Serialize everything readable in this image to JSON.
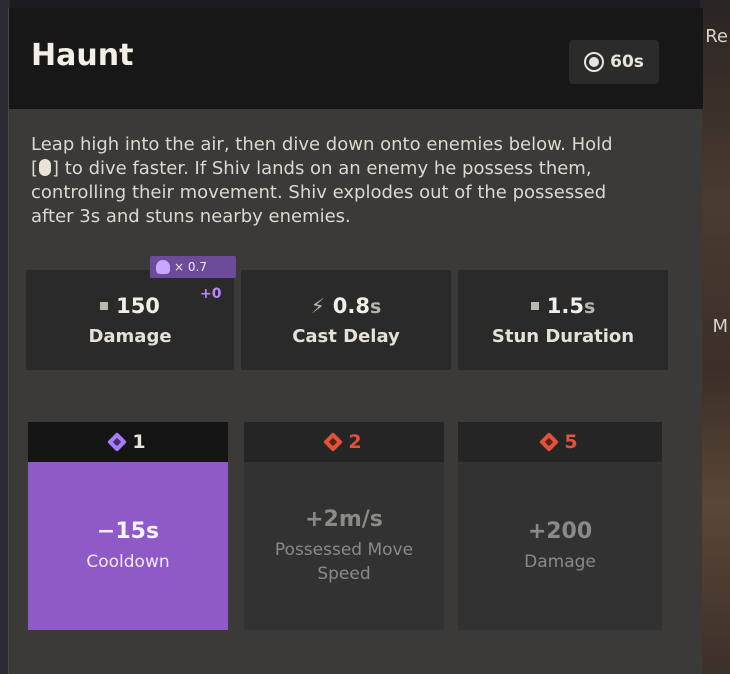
{
  "ability": {
    "name": "Haunt",
    "cooldown": "60s",
    "description_lines": [
      "Leap high into the air, then dive down onto enemies below. Hold",
      "] to dive faster. If Shiv lands on an enemy he possess them,",
      "controlling their movement. Shiv explodes out of the possessed",
      "after 3s and stuns nearby enemies."
    ],
    "description_line2_prefix": "["
  },
  "scaling": {
    "multiplier": "× 0.7",
    "bonus": "+0",
    "icon": "spirit-skull-icon",
    "color": "#6b4b9a"
  },
  "stats": [
    {
      "value": "150",
      "unit": "",
      "label": "Damage",
      "icon": "damage-square-icon"
    },
    {
      "value": "0.8",
      "unit": "s",
      "label": "Cast Delay",
      "icon": "bolt-icon"
    },
    {
      "value": "1.5",
      "unit": "s",
      "label": "Stun Duration",
      "icon": "duration-square-icon"
    }
  ],
  "upgrades": [
    {
      "tier": "1",
      "value": "−15s",
      "label_lines": [
        "Cooldown"
      ],
      "state": "unlocked",
      "color": "#8f59c7"
    },
    {
      "tier": "2",
      "value": "+2m/s",
      "label_lines": [
        "Possessed Move",
        "Speed"
      ],
      "state": "locked",
      "color": "#e0533a"
    },
    {
      "tier": "5",
      "value": "+200",
      "label_lines": [
        "Damage"
      ],
      "state": "locked",
      "color": "#e0533a"
    }
  ],
  "background": {
    "right_text_1": "Re",
    "right_text_2": "M"
  }
}
